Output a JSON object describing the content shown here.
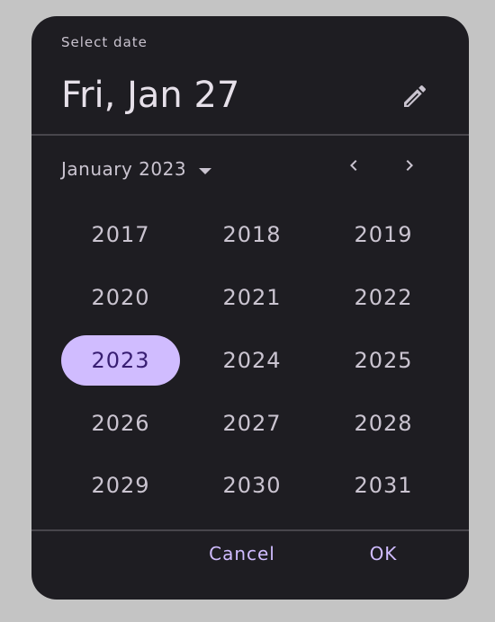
{
  "dialog": {
    "header_label": "Select date",
    "headline": "Fri, Jan 27",
    "month_year_label": "January 2023",
    "years": [
      "2017",
      "2018",
      "2019",
      "2020",
      "2021",
      "2022",
      "2023",
      "2024",
      "2025",
      "2026",
      "2027",
      "2028",
      "2029",
      "2030",
      "2031"
    ],
    "selected_year": "2023",
    "cancel_label": "Cancel",
    "ok_label": "OK"
  },
  "icons": {
    "edit": "pencil-icon",
    "dropdown": "arrow-drop-down-icon",
    "prev": "chevron-left-icon",
    "next": "chevron-right-icon"
  },
  "colors": {
    "surface": "#1e1d22",
    "on_surface": "#e6e0e9",
    "on_surface_variant": "#cac4d0",
    "primary": "#d0bcff",
    "on_primary": "#381e72",
    "divider": "#48464c",
    "backdrop": "#c4c4c4"
  }
}
